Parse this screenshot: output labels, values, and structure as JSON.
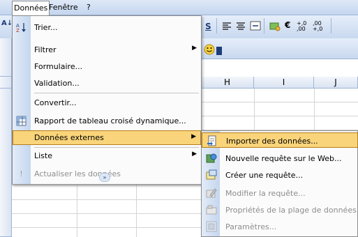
{
  "menubar": {
    "donnees": "Données",
    "fenetre": "Fenêtre",
    "aide": "?"
  },
  "toolbar": {
    "sort_icon": "sort-ascending-icon",
    "bold_s": "S",
    "currency_symbol": "€",
    "add_decimal": "+,0 ,00",
    "remove_decimal": ",00 +,0"
  },
  "columns": [
    "H",
    "I",
    "J"
  ],
  "menu": {
    "items": [
      {
        "label": "Trier...",
        "icon": "sort-icon",
        "has_submenu": false
      },
      {
        "label": "Filtrer",
        "icon": "",
        "has_submenu": true
      },
      {
        "label": "Formulaire...",
        "icon": "",
        "has_submenu": false
      },
      {
        "label": "Validation...",
        "icon": "",
        "has_submenu": false
      },
      {
        "label": "Convertir...",
        "icon": "",
        "has_submenu": false
      },
      {
        "label": "Rapport de tableau croisé dynamique...",
        "icon": "pivot-table-icon",
        "has_submenu": false
      },
      {
        "label": "Données externes",
        "icon": "",
        "has_submenu": true,
        "highlighted": true
      },
      {
        "label": "Liste",
        "icon": "",
        "has_submenu": true
      },
      {
        "label": "Actualiser les données",
        "icon": "refresh-icon",
        "has_submenu": false,
        "disabled": true
      }
    ],
    "expand_glyph": "»"
  },
  "submenu": {
    "items": [
      {
        "label": "Importer des données...",
        "icon": "import-data-icon",
        "highlighted": true
      },
      {
        "label": "Nouvelle requête sur le Web...",
        "icon": "web-query-icon"
      },
      {
        "label": "Créer une requête...",
        "icon": "new-query-icon"
      },
      {
        "label": "Modifier la requête...",
        "icon": "edit-query-icon",
        "disabled": true
      },
      {
        "label": "Propriétés de la plage de données...",
        "icon": "range-properties-icon",
        "disabled": true
      },
      {
        "label": "Paramètres...",
        "icon": "parameters-icon",
        "disabled": true
      }
    ]
  },
  "colors": {
    "highlight": "#f9d47a",
    "highlight_border": "#b77d1a",
    "gutter": "#c4d6ef",
    "disabled_text": "#8d8d8d"
  }
}
